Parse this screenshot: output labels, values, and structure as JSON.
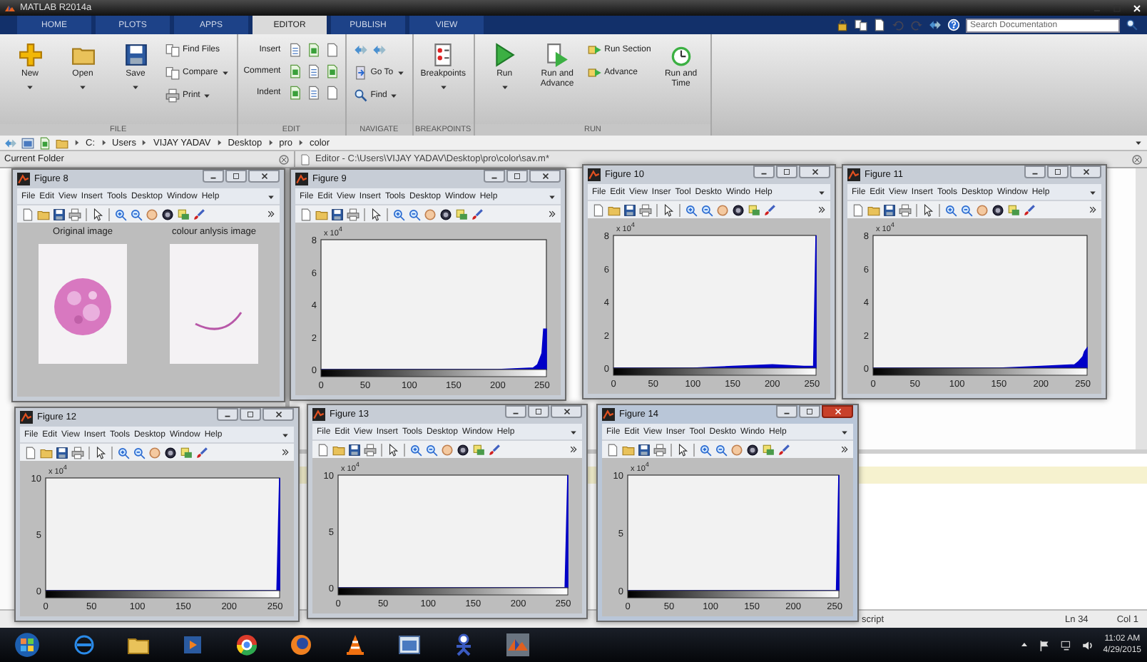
{
  "window": {
    "title": "MATLAB R2014a"
  },
  "tabs": [
    {
      "label": "HOME",
      "selected": false
    },
    {
      "label": "PLOTS",
      "selected": false
    },
    {
      "label": "APPS",
      "selected": false
    },
    {
      "label": "EDITOR",
      "selected": true
    },
    {
      "label": "PUBLISH",
      "selected": false
    },
    {
      "label": "VIEW",
      "selected": false
    }
  ],
  "search": {
    "placeholder": "Search Documentation"
  },
  "ribbon": [
    {
      "label": "FILE",
      "items": [
        {
          "kind": "large",
          "label": "New",
          "caret": true
        },
        {
          "kind": "large",
          "label": "Open",
          "caret": true
        },
        {
          "kind": "large",
          "label": "Save",
          "caret": true
        },
        {
          "kind": "stack",
          "items": [
            {
              "kind": "button",
              "label": "Find Files",
              "caret": false
            },
            {
              "kind": "button",
              "label": "Compare",
              "caret": true
            },
            {
              "kind": "button",
              "label": "Print",
              "caret": true
            }
          ]
        }
      ]
    },
    {
      "label": "EDIT",
      "items": [
        {
          "kind": "rows",
          "rows": [
            {
              "label": "Insert"
            },
            {
              "label": "Comment"
            },
            {
              "label": "Indent"
            }
          ]
        }
      ]
    },
    {
      "label": "NAVIGATE",
      "items": [
        {
          "kind": "stack",
          "items": [
            {
              "kind": "icons"
            },
            {
              "kind": "button",
              "label": "Go To",
              "caret": true
            },
            {
              "kind": "button",
              "label": "Find",
              "caret": true
            }
          ]
        }
      ]
    },
    {
      "label": "BREAKPOINTS",
      "items": [
        {
          "kind": "large",
          "label": "Breakpoints",
          "caret": true
        }
      ]
    },
    {
      "label": "RUN",
      "items": [
        {
          "kind": "large",
          "label": "Run",
          "caret": true
        },
        {
          "kind": "large",
          "label": "Run and Advance",
          "caret": false
        },
        {
          "kind": "stack",
          "items": [
            {
              "kind": "button",
              "label": "Run Section",
              "caret": false
            },
            {
              "kind": "button",
              "label": "Advance",
              "caret": false
            }
          ]
        },
        {
          "kind": "large",
          "label": "Run and Time",
          "caret": false
        }
      ]
    }
  ],
  "address": {
    "path": [
      "C:",
      "Users",
      "VIJAY YADAV",
      "Desktop",
      "pro",
      "color"
    ]
  },
  "panels": {
    "current_folder": "Current Folder",
    "editor": "Editor - C:\\Users\\VIJAY YADAV\\Desktop\\pro\\color\\sav.m*"
  },
  "figures": [
    {
      "title": "Figure 8",
      "active": false,
      "kind": "images",
      "menus": [
        "File",
        "Edit",
        "View",
        "Insert",
        "Tools",
        "Desktop",
        "Window",
        "Help"
      ],
      "captions": [
        "Original image",
        "colour anlysis image"
      ]
    },
    {
      "title": "Figure 9",
      "active": false,
      "kind": "histogram",
      "menus": [
        "File",
        "Edit",
        "View",
        "Insert",
        "Tools",
        "Desktop",
        "Window",
        "Help"
      ],
      "axis_multiplier": "x 10$^{4}$",
      "chart_data": {
        "type": "area",
        "x": [
          0,
          50,
          100,
          150,
          200,
          240,
          245,
          250,
          252,
          255
        ],
        "series": [
          {
            "color": "#0000c8",
            "values": [
              0,
              0,
              0,
              0,
              0,
              0.1,
              0.3,
              1,
              2.5,
              2.5
            ]
          }
        ],
        "xlim": [
          0,
          255
        ],
        "ylim": [
          0,
          8
        ],
        "xticks": [
          0,
          50,
          100,
          150,
          200,
          250
        ],
        "yticks": [
          0,
          2,
          4,
          6,
          8
        ]
      }
    },
    {
      "title": "Figure 10",
      "active": false,
      "kind": "histogram",
      "menus": [
        "File",
        "Edit",
        "View",
        "Inser",
        "Tool",
        "Deskto",
        "Windo",
        "Help"
      ],
      "axis_multiplier": "x 10$^{4}$",
      "chart_data": {
        "type": "area",
        "x": [
          0,
          50,
          100,
          150,
          200,
          240,
          245,
          250,
          252,
          255
        ],
        "series": [
          {
            "color": "#0000c8",
            "values": [
              0,
              0,
              0,
              0.1,
              0.2,
              0.1,
              0.1,
              0.1,
              0.1,
              8
            ]
          }
        ],
        "xlim": [
          0,
          255
        ],
        "ylim": [
          0,
          8
        ],
        "xticks": [
          0,
          50,
          100,
          150,
          200,
          250
        ],
        "yticks": [
          0,
          2,
          4,
          6,
          8
        ]
      }
    },
    {
      "title": "Figure 11",
      "active": false,
      "kind": "histogram",
      "menus": [
        "File",
        "Edit",
        "View",
        "Insert",
        "Tools",
        "Desktop",
        "Window",
        "Help"
      ],
      "axis_multiplier": "x 10$^{4}$",
      "chart_data": {
        "type": "area",
        "x": [
          0,
          50,
          100,
          150,
          200,
          240,
          245,
          250,
          252,
          255
        ],
        "series": [
          {
            "color": "#0000c8",
            "values": [
              0,
              0,
              0,
              0,
              0.1,
              0.2,
              0.4,
              0.7,
              1,
              1.2
            ]
          }
        ],
        "xlim": [
          0,
          255
        ],
        "ylim": [
          0,
          8
        ],
        "xticks": [
          0,
          50,
          100,
          150,
          200,
          250
        ],
        "yticks": [
          0,
          2,
          4,
          6,
          8
        ]
      }
    },
    {
      "title": "Figure 12",
      "active": false,
      "kind": "histogram",
      "menus": [
        "File",
        "Edit",
        "View",
        "Insert",
        "Tools",
        "Desktop",
        "Window",
        "Help"
      ],
      "axis_multiplier": "x 10$^{4}$",
      "chart_data": {
        "type": "area",
        "x": [
          0,
          50,
          100,
          150,
          200,
          240,
          245,
          250,
          252,
          255
        ],
        "series": [
          {
            "color": "#0000c8",
            "values": [
              0,
              0,
              0,
              0,
              0,
              0,
              0,
              0,
              0,
              10
            ]
          }
        ],
        "xlim": [
          0,
          255
        ],
        "ylim": [
          0,
          10
        ],
        "xticks": [
          0,
          50,
          100,
          150,
          200,
          250
        ],
        "yticks": [
          0,
          5,
          10
        ]
      }
    },
    {
      "title": "Figure 13",
      "active": false,
      "kind": "histogram",
      "menus": [
        "File",
        "Edit",
        "View",
        "Insert",
        "Tools",
        "Desktop",
        "Window",
        "Help"
      ],
      "axis_multiplier": "x 10$^{4}$",
      "chart_data": {
        "type": "area",
        "x": [
          0,
          50,
          100,
          150,
          200,
          240,
          245,
          250,
          252,
          255
        ],
        "series": [
          {
            "color": "#0000c8",
            "values": [
              0,
              0,
              0,
              0,
              0,
              0,
              0,
              0,
              0,
              10
            ]
          }
        ],
        "xlim": [
          0,
          255
        ],
        "ylim": [
          0,
          10
        ],
        "xticks": [
          0,
          50,
          100,
          150,
          200,
          250
        ],
        "yticks": [
          0,
          5,
          10
        ]
      }
    },
    {
      "title": "Figure 14",
      "active": true,
      "kind": "histogram",
      "menus": [
        "File",
        "Edit",
        "View",
        "Inser",
        "Tool",
        "Deskto",
        "Windo",
        "Help"
      ],
      "axis_multiplier": "x 10$^{4}$",
      "chart_data": {
        "type": "area",
        "x": [
          0,
          50,
          100,
          150,
          200,
          240,
          245,
          250,
          252,
          255
        ],
        "series": [
          {
            "color": "#0000c8",
            "values": [
              0,
              0,
              0,
              0,
              0,
              0,
              0,
              0,
              0,
              10
            ]
          }
        ],
        "xlim": [
          0,
          255
        ],
        "ylim": [
          0,
          10
        ],
        "xticks": [
          0,
          50,
          100,
          150,
          200,
          250
        ],
        "yticks": [
          0,
          5,
          10
        ]
      }
    }
  ],
  "status_bar": {
    "mode": "script",
    "line": "Ln 34",
    "column": "Col 1"
  },
  "taskbar": {
    "time": "11:02 AM",
    "date": "4/29/2015"
  }
}
